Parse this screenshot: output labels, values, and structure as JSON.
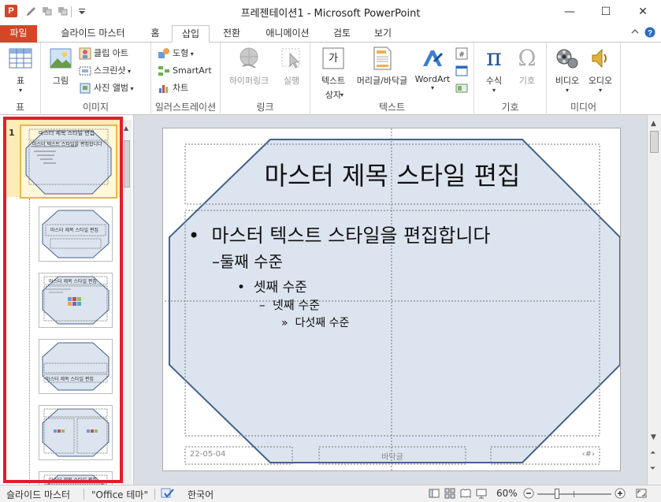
{
  "window": {
    "title": "프레젠테이션1 - Microsoft PowerPoint",
    "app_icon": "P",
    "minimize": "—",
    "maximize": "☐",
    "close": "✕"
  },
  "tabs": [
    {
      "label": "파일"
    },
    {
      "label": "슬라이드 마스터"
    },
    {
      "label": "홈"
    },
    {
      "label": "삽입"
    },
    {
      "label": "전환"
    },
    {
      "label": "애니메이션"
    },
    {
      "label": "검토"
    },
    {
      "label": "보기"
    }
  ],
  "ribbon": {
    "groups": {
      "table": "표",
      "images": "이미지",
      "illustrations": "일러스트레이션",
      "links": "링크",
      "text": "텍스트",
      "symbols": "기호",
      "media": "미디어"
    },
    "buttons": {
      "table": "표",
      "picture": "그림",
      "clipart": "클립 아트",
      "screenshot": "스크린샷",
      "photo_album": "사진 앨범",
      "shapes": "도형",
      "smartart": "SmartArt",
      "chart": "차트",
      "hyperlink": "하이퍼링크",
      "action": "실행",
      "textbox_1": "텍스트",
      "textbox_2": "상자",
      "header_footer": "머리글/바닥글",
      "wordart": "WordArt",
      "equation": "수식",
      "symbol": "기호",
      "video": "비디오",
      "audio": "오디오"
    },
    "icon_glyphs": {
      "textbox": "가",
      "equation": "π",
      "symbol": "Ω"
    }
  },
  "thumbnails": {
    "selected_number": "1",
    "slide1_title": "마스터 제목 스타일 편집",
    "slide1_body": "마스터 텍스트 스타일을 편집합니다",
    "slide2_title": "마스터 제목 스타일 편집",
    "slide3_title": "마스터 제목 스타일 편집",
    "slide4_title": "마스터 제목 스타일 편집",
    "slide6_title": "마스터 제목 스타일 편집"
  },
  "slide": {
    "title": "마스터 제목 스타일 편집",
    "level1": "마스터 텍스트 스타일을 편집합니다",
    "level2": "둘째 수준",
    "level3": "셋째 수준",
    "level4": "넷째 수준",
    "level5": "다섯째 수준",
    "bullet1": "•",
    "bullet2": "–",
    "bullet3": "•",
    "bullet4": "–",
    "bullet5": "»",
    "footer_date": "22-05-04",
    "footer_center": "바닥글",
    "footer_number": "‹#›"
  },
  "statusbar": {
    "view": "슬라이드 마스터",
    "theme": "\"Office 테마\"",
    "language": "한국어",
    "zoom": "60%"
  },
  "colors": {
    "accent": "#d24726",
    "octagon_fill": "#dce4ef",
    "octagon_stroke": "#44628c",
    "highlight": "#e11d2a"
  }
}
